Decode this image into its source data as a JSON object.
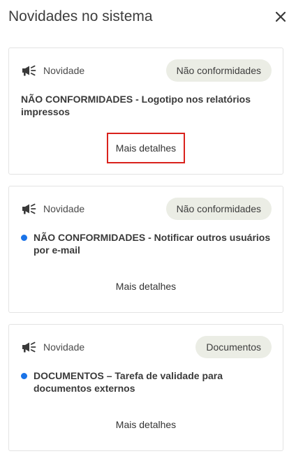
{
  "header": {
    "title": "Novidades no sistema",
    "close_icon": "close-icon"
  },
  "cards": [
    {
      "type_label": "Novidade",
      "type_icon": "megaphone-icon",
      "category": "Não conformidades",
      "text": "NÃO CONFORMIDADES - Logotipo nos relatórios impressos",
      "unread": false,
      "action_label": "Mais detalhes",
      "action_focused": true
    },
    {
      "type_label": "Novidade",
      "type_icon": "megaphone-icon",
      "category": "Não conformidades",
      "text": "NÃO CONFORMIDADES - Notificar outros usuários por e-mail",
      "unread": true,
      "action_label": "Mais detalhes",
      "action_focused": false
    },
    {
      "type_label": "Novidade",
      "type_icon": "megaphone-icon",
      "category": "Documentos",
      "text": "DOCUMENTOS – Tarefa de validade para documentos externos",
      "unread": true,
      "action_label": "Mais detalhes",
      "action_focused": false
    }
  ],
  "colors": {
    "unread_dot": "#1a73e8",
    "chip_background": "#ebede5",
    "focus_outline": "#d9221c"
  }
}
